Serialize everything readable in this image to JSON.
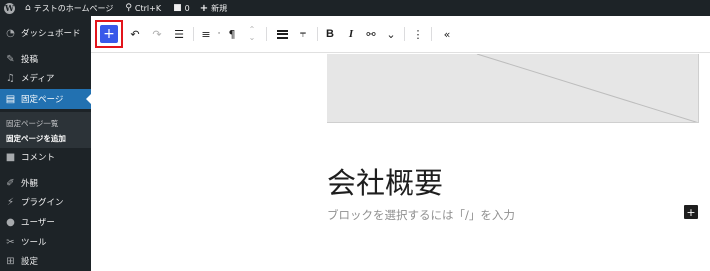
{
  "adminbar": {
    "site_name": "テストのホームページ",
    "search_shortcut": "Ctrl+K",
    "comments_count": "0",
    "new_label": "新規"
  },
  "sidebar": {
    "items": [
      {
        "label": "ダッシュボード",
        "icon": "dashboard-icon"
      },
      {
        "label": "投稿",
        "icon": "pin-icon"
      },
      {
        "label": "メディア",
        "icon": "media-icon"
      },
      {
        "label": "固定ページ",
        "icon": "page-icon"
      },
      {
        "label": "コメント",
        "icon": "comment-icon"
      },
      {
        "label": "外観",
        "icon": "brush-icon"
      },
      {
        "label": "プラグイン",
        "icon": "plugin-icon"
      },
      {
        "label": "ユーザー",
        "icon": "user-icon"
      },
      {
        "label": "ツール",
        "icon": "wrench-icon"
      },
      {
        "label": "設定",
        "icon": "settings-icon"
      }
    ],
    "submenu": [
      "固定ページ一覧",
      "固定ページを追加"
    ]
  },
  "toolbar": {
    "inserter": "+",
    "undo": "↶",
    "redo": "↷",
    "list_view": "☰",
    "align": "≡",
    "paragraph": "¶",
    "move": "⌃⌄",
    "bold": "B",
    "italic": "I",
    "link": "⚯",
    "more": "⌄",
    "options": "⋮",
    "collapse": "«"
  },
  "content": {
    "heading": "会社概要",
    "placeholder": "ブロックを選択するには「/」を入力",
    "add_block": "+"
  },
  "colors": {
    "admin_dark": "#1d2327",
    "accent_blue": "#2271b1",
    "inserter_blue": "#3858e9",
    "highlight_red": "#e2141b"
  }
}
